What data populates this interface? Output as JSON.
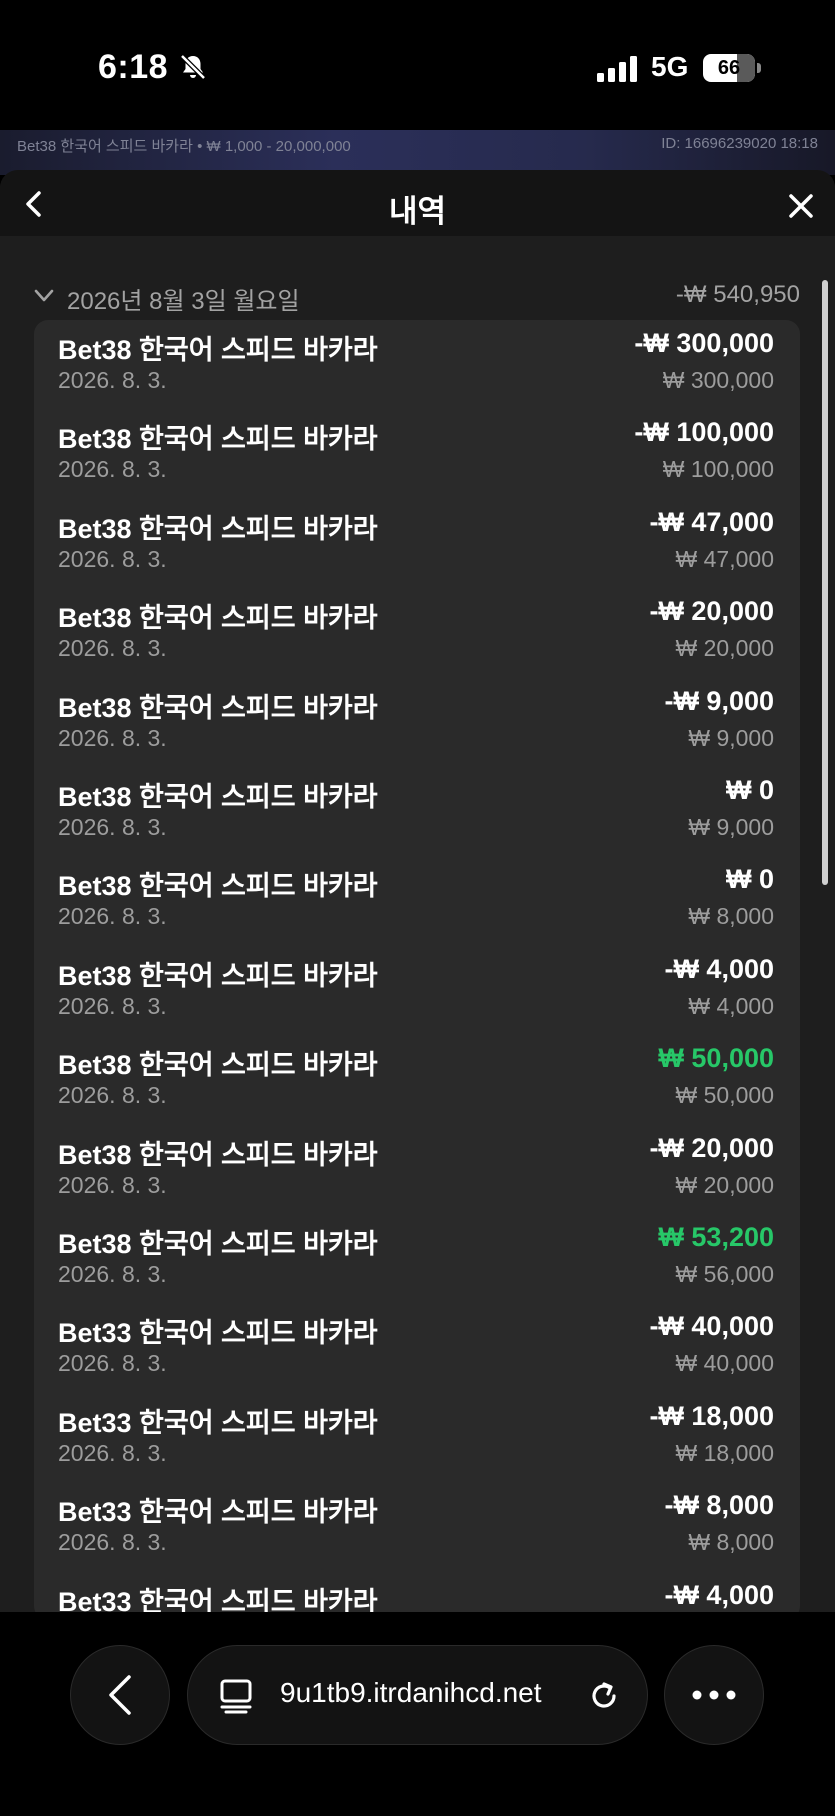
{
  "status_bar": {
    "time": "6:18",
    "network": "5G",
    "battery": "66",
    "battery_percent": 66
  },
  "game_strip": {
    "info": "Bet38 한국어 스피드 바카라 • ₩ 1,000 - 20,000,000",
    "id": "ID: 16696239020 18:18"
  },
  "sheet": {
    "title": "내역",
    "day": {
      "date": "2026년 8월 3일 월요일",
      "total": "-₩ 540,950"
    },
    "rows": [
      {
        "title": "Bet38 한국어 스피드 바카라",
        "date": "2026. 8. 3.",
        "amount": "-₩ 300,000",
        "stake": "₩ 300,000",
        "win": false
      },
      {
        "title": "Bet38 한국어 스피드 바카라",
        "date": "2026. 8. 3.",
        "amount": "-₩ 100,000",
        "stake": "₩ 100,000",
        "win": false
      },
      {
        "title": "Bet38 한국어 스피드 바카라",
        "date": "2026. 8. 3.",
        "amount": "-₩ 47,000",
        "stake": "₩ 47,000",
        "win": false
      },
      {
        "title": "Bet38 한국어 스피드 바카라",
        "date": "2026. 8. 3.",
        "amount": "-₩ 20,000",
        "stake": "₩ 20,000",
        "win": false
      },
      {
        "title": "Bet38 한국어 스피드 바카라",
        "date": "2026. 8. 3.",
        "amount": "-₩ 9,000",
        "stake": "₩ 9,000",
        "win": false
      },
      {
        "title": "Bet38 한국어 스피드 바카라",
        "date": "2026. 8. 3.",
        "amount": "₩ 0",
        "stake": "₩ 9,000",
        "win": false
      },
      {
        "title": "Bet38 한국어 스피드 바카라",
        "date": "2026. 8. 3.",
        "amount": "₩ 0",
        "stake": "₩ 8,000",
        "win": false
      },
      {
        "title": "Bet38 한국어 스피드 바카라",
        "date": "2026. 8. 3.",
        "amount": "-₩ 4,000",
        "stake": "₩ 4,000",
        "win": false
      },
      {
        "title": "Bet38 한국어 스피드 바카라",
        "date": "2026. 8. 3.",
        "amount": "₩ 50,000",
        "stake": "₩ 50,000",
        "win": true
      },
      {
        "title": "Bet38 한국어 스피드 바카라",
        "date": "2026. 8. 3.",
        "amount": "-₩ 20,000",
        "stake": "₩ 20,000",
        "win": false
      },
      {
        "title": "Bet38 한국어 스피드 바카라",
        "date": "2026. 8. 3.",
        "amount": "₩ 53,200",
        "stake": "₩ 56,000",
        "win": true
      },
      {
        "title": "Bet33 한국어 스피드 바카라",
        "date": "2026. 8. 3.",
        "amount": "-₩ 40,000",
        "stake": "₩ 40,000",
        "win": false
      },
      {
        "title": "Bet33 한국어 스피드 바카라",
        "date": "2026. 8. 3.",
        "amount": "-₩ 18,000",
        "stake": "₩ 18,000",
        "win": false
      },
      {
        "title": "Bet33 한국어 스피드 바카라",
        "date": "2026. 8. 3.",
        "amount": "-₩ 8,000",
        "stake": "₩ 8,000",
        "win": false
      },
      {
        "title": "Bet33 한국어 스피드 바카라",
        "date": "",
        "amount": "-₩ 4,000",
        "stake": "",
        "win": false
      }
    ]
  },
  "browser": {
    "url": "9u1tb9.itrdanihcd.net"
  },
  "colors": {
    "win": "#27c768",
    "sheet_bg": "#1e1e1e",
    "list_bg": "#2a2a2a",
    "muted": "#9d9d9d"
  },
  "icons": {
    "status": [
      "bell-slash-icon",
      "signal-icon",
      "battery-icon"
    ],
    "header": [
      "chevron-left-icon",
      "close-icon",
      "chevron-down-icon"
    ],
    "browser": [
      "chevron-left-icon",
      "tabs-icon",
      "reload-icon",
      "more-icon"
    ]
  }
}
